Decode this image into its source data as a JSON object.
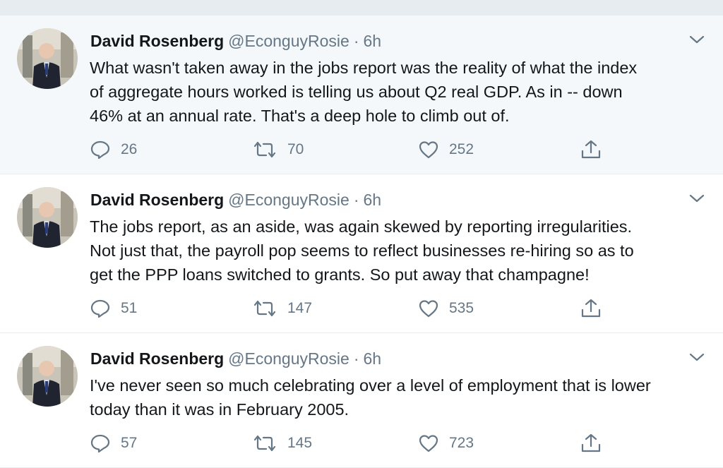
{
  "tweets": [
    {
      "name": "David Rosenberg",
      "handle": "@EconguyRosie",
      "separator": "·",
      "time": "6h",
      "lines": [
        "What wasn't taken away in the jobs report was the reality of what the index",
        "of aggregate hours worked is telling us about Q2 real GDP. As in -- down",
        "46% at an annual rate. That's a deep hole to climb out of."
      ],
      "replies": "26",
      "retweets": "70",
      "likes": "252"
    },
    {
      "name": "David Rosenberg",
      "handle": "@EconguyRosie",
      "separator": "·",
      "time": "6h",
      "lines": [
        "The jobs report, as an aside, was again skewed by reporting irregularities.",
        "Not just that, the payroll pop seems to reflect businesses re-hiring so as to",
        "get the PPP loans switched to grants. So put away that champagne!"
      ],
      "replies": "51",
      "retweets": "147",
      "likes": "535"
    },
    {
      "name": "David Rosenberg",
      "handle": "@EconguyRosie",
      "separator": "·",
      "time": "6h",
      "lines": [
        "I've never seen so much celebrating over a level of employment that is lower",
        "today than it was in February 2005."
      ],
      "replies": "57",
      "retweets": "145",
      "likes": "723"
    }
  ],
  "icons": {
    "reply": "reply-icon",
    "retweet": "retweet-icon",
    "like": "heart-icon",
    "share": "share-icon",
    "more": "chevron-down-icon"
  },
  "colors": {
    "text": "#14171a",
    "secondary": "#657786",
    "highlight_bg": "#f5f8fa",
    "divider": "#e6ecf0"
  }
}
